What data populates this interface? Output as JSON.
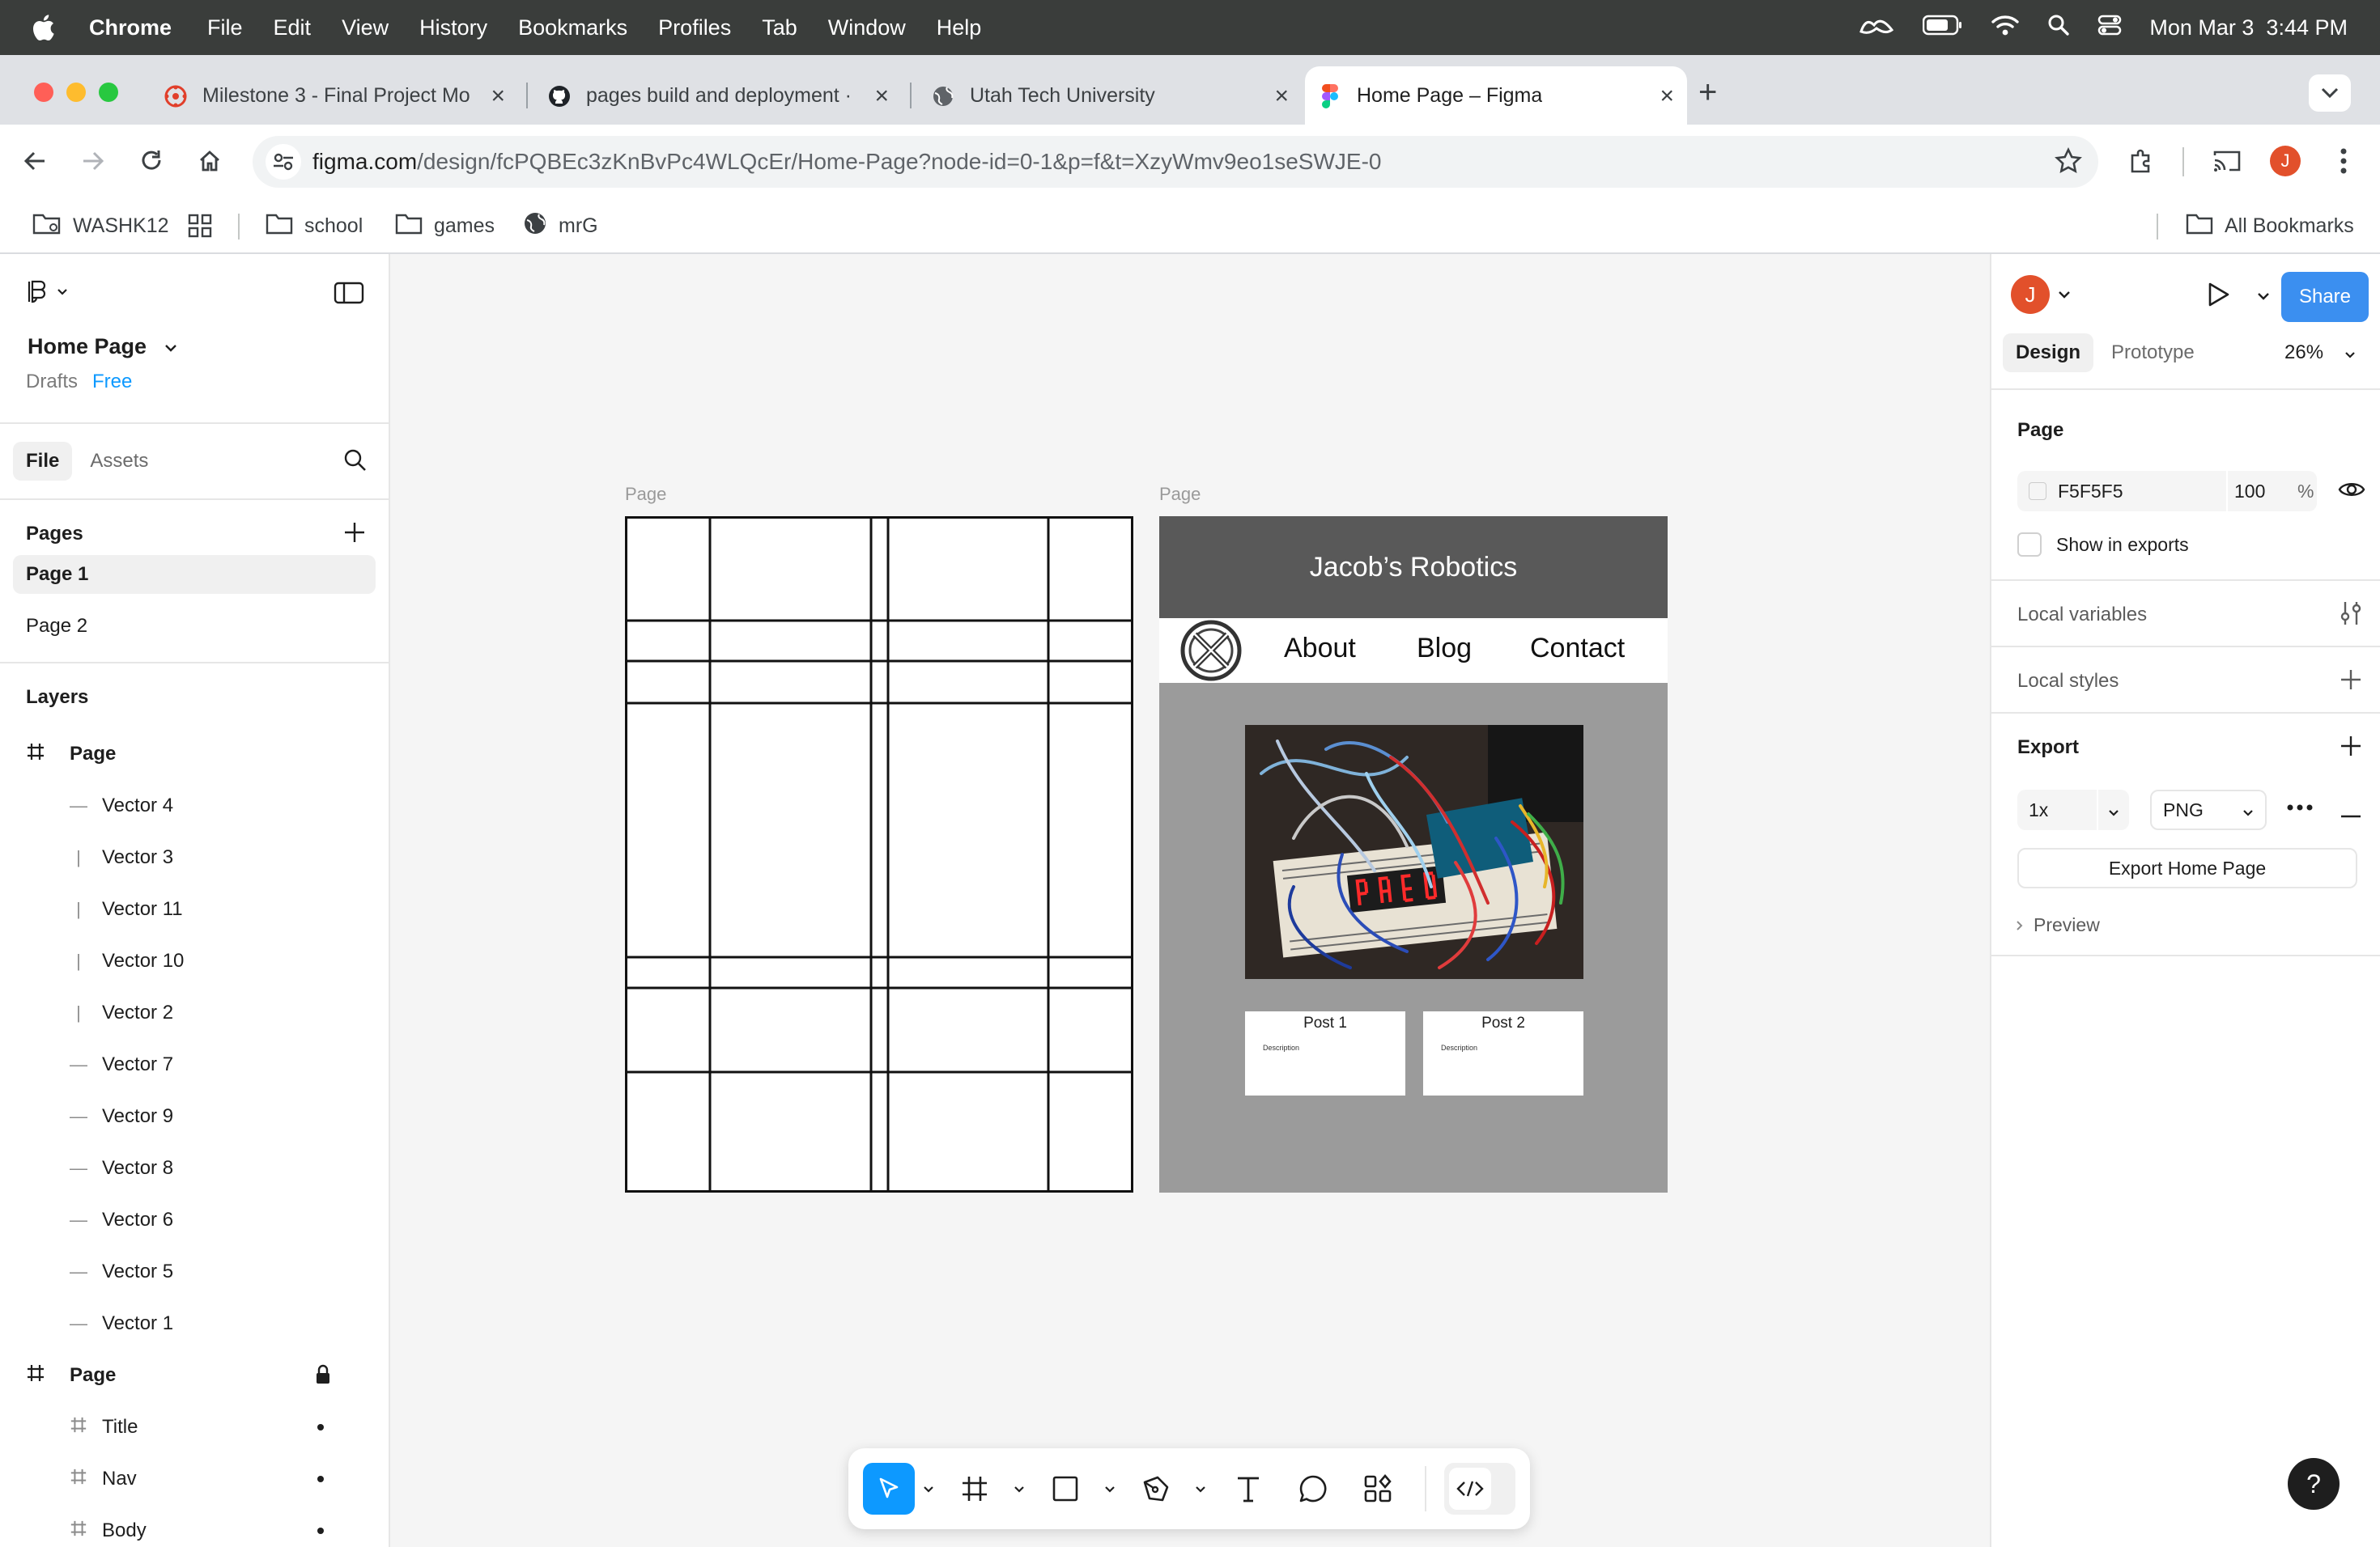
{
  "menubar": {
    "app": "Chrome",
    "items": [
      "File",
      "Edit",
      "View",
      "History",
      "Bookmarks",
      "Profiles",
      "Tab",
      "Window",
      "Help"
    ],
    "datetime": "Mon Mar 3  3:44 PM"
  },
  "tabs": [
    {
      "title": "Milestone 3 - Final Project Mo",
      "icon": "canvas-icon"
    },
    {
      "title": "pages build and deployment ·",
      "icon": "github-icon"
    },
    {
      "title": "Utah Tech University",
      "icon": "globe-icon"
    },
    {
      "title": "Home Page – Figma",
      "icon": "figma-icon"
    }
  ],
  "address": {
    "domain": "figma.com",
    "path": "/design/fcPQBEc3zKnBvPc4WLQcEr/Home-Page?node-id=0-1&p=f&t=XzyWmv9eo1seSWJE-0"
  },
  "bookmarks": {
    "items": [
      "WASHK12",
      "school",
      "games",
      "mrG"
    ],
    "all": "All Bookmarks"
  },
  "profile_initial": "J",
  "left": {
    "file_name": "Home Page",
    "drafts": "Drafts",
    "plan": "Free",
    "tab_file": "File",
    "tab_assets": "Assets",
    "pages_heading": "Pages",
    "pages": [
      "Page 1",
      "Page 2"
    ],
    "layers_heading": "Layers",
    "frame1": "Page",
    "vectors": [
      "Vector 4",
      "Vector 3",
      "Vector 11",
      "Vector 10",
      "Vector 2",
      "Vector 7",
      "Vector 9",
      "Vector 8",
      "Vector 6",
      "Vector 5",
      "Vector 1"
    ],
    "frame2": "Page",
    "children": [
      "Title",
      "Nav",
      "Body"
    ]
  },
  "canvas": {
    "frame_label_1": "Page",
    "frame_label_2": "Page",
    "site_title": "Jacob’s Robotics",
    "nav": [
      "About",
      "Blog",
      "Contact"
    ],
    "posts": [
      {
        "title": "Post 1",
        "desc": "Description"
      },
      {
        "title": "Post 2",
        "desc": "Description"
      }
    ],
    "led_text": "HELO"
  },
  "right": {
    "share": "Share",
    "tab_design": "Design",
    "tab_prototype": "Prototype",
    "zoom": "26%",
    "page_heading": "Page",
    "bg_hex": "F5F5F5",
    "opacity": "100",
    "pct": "%",
    "show_in_exports": "Show in exports",
    "local_variables": "Local variables",
    "local_styles": "Local styles",
    "export_heading": "Export",
    "export_scale": "1x",
    "export_format": "PNG",
    "export_button": "Export Home Page",
    "preview": "Preview"
  },
  "colors": {
    "accent": "#0d99ff",
    "share": "#3b8ff0",
    "avatar": "#e2502b",
    "frame_gray": "#9b9b9b",
    "header_gray": "#595959"
  }
}
